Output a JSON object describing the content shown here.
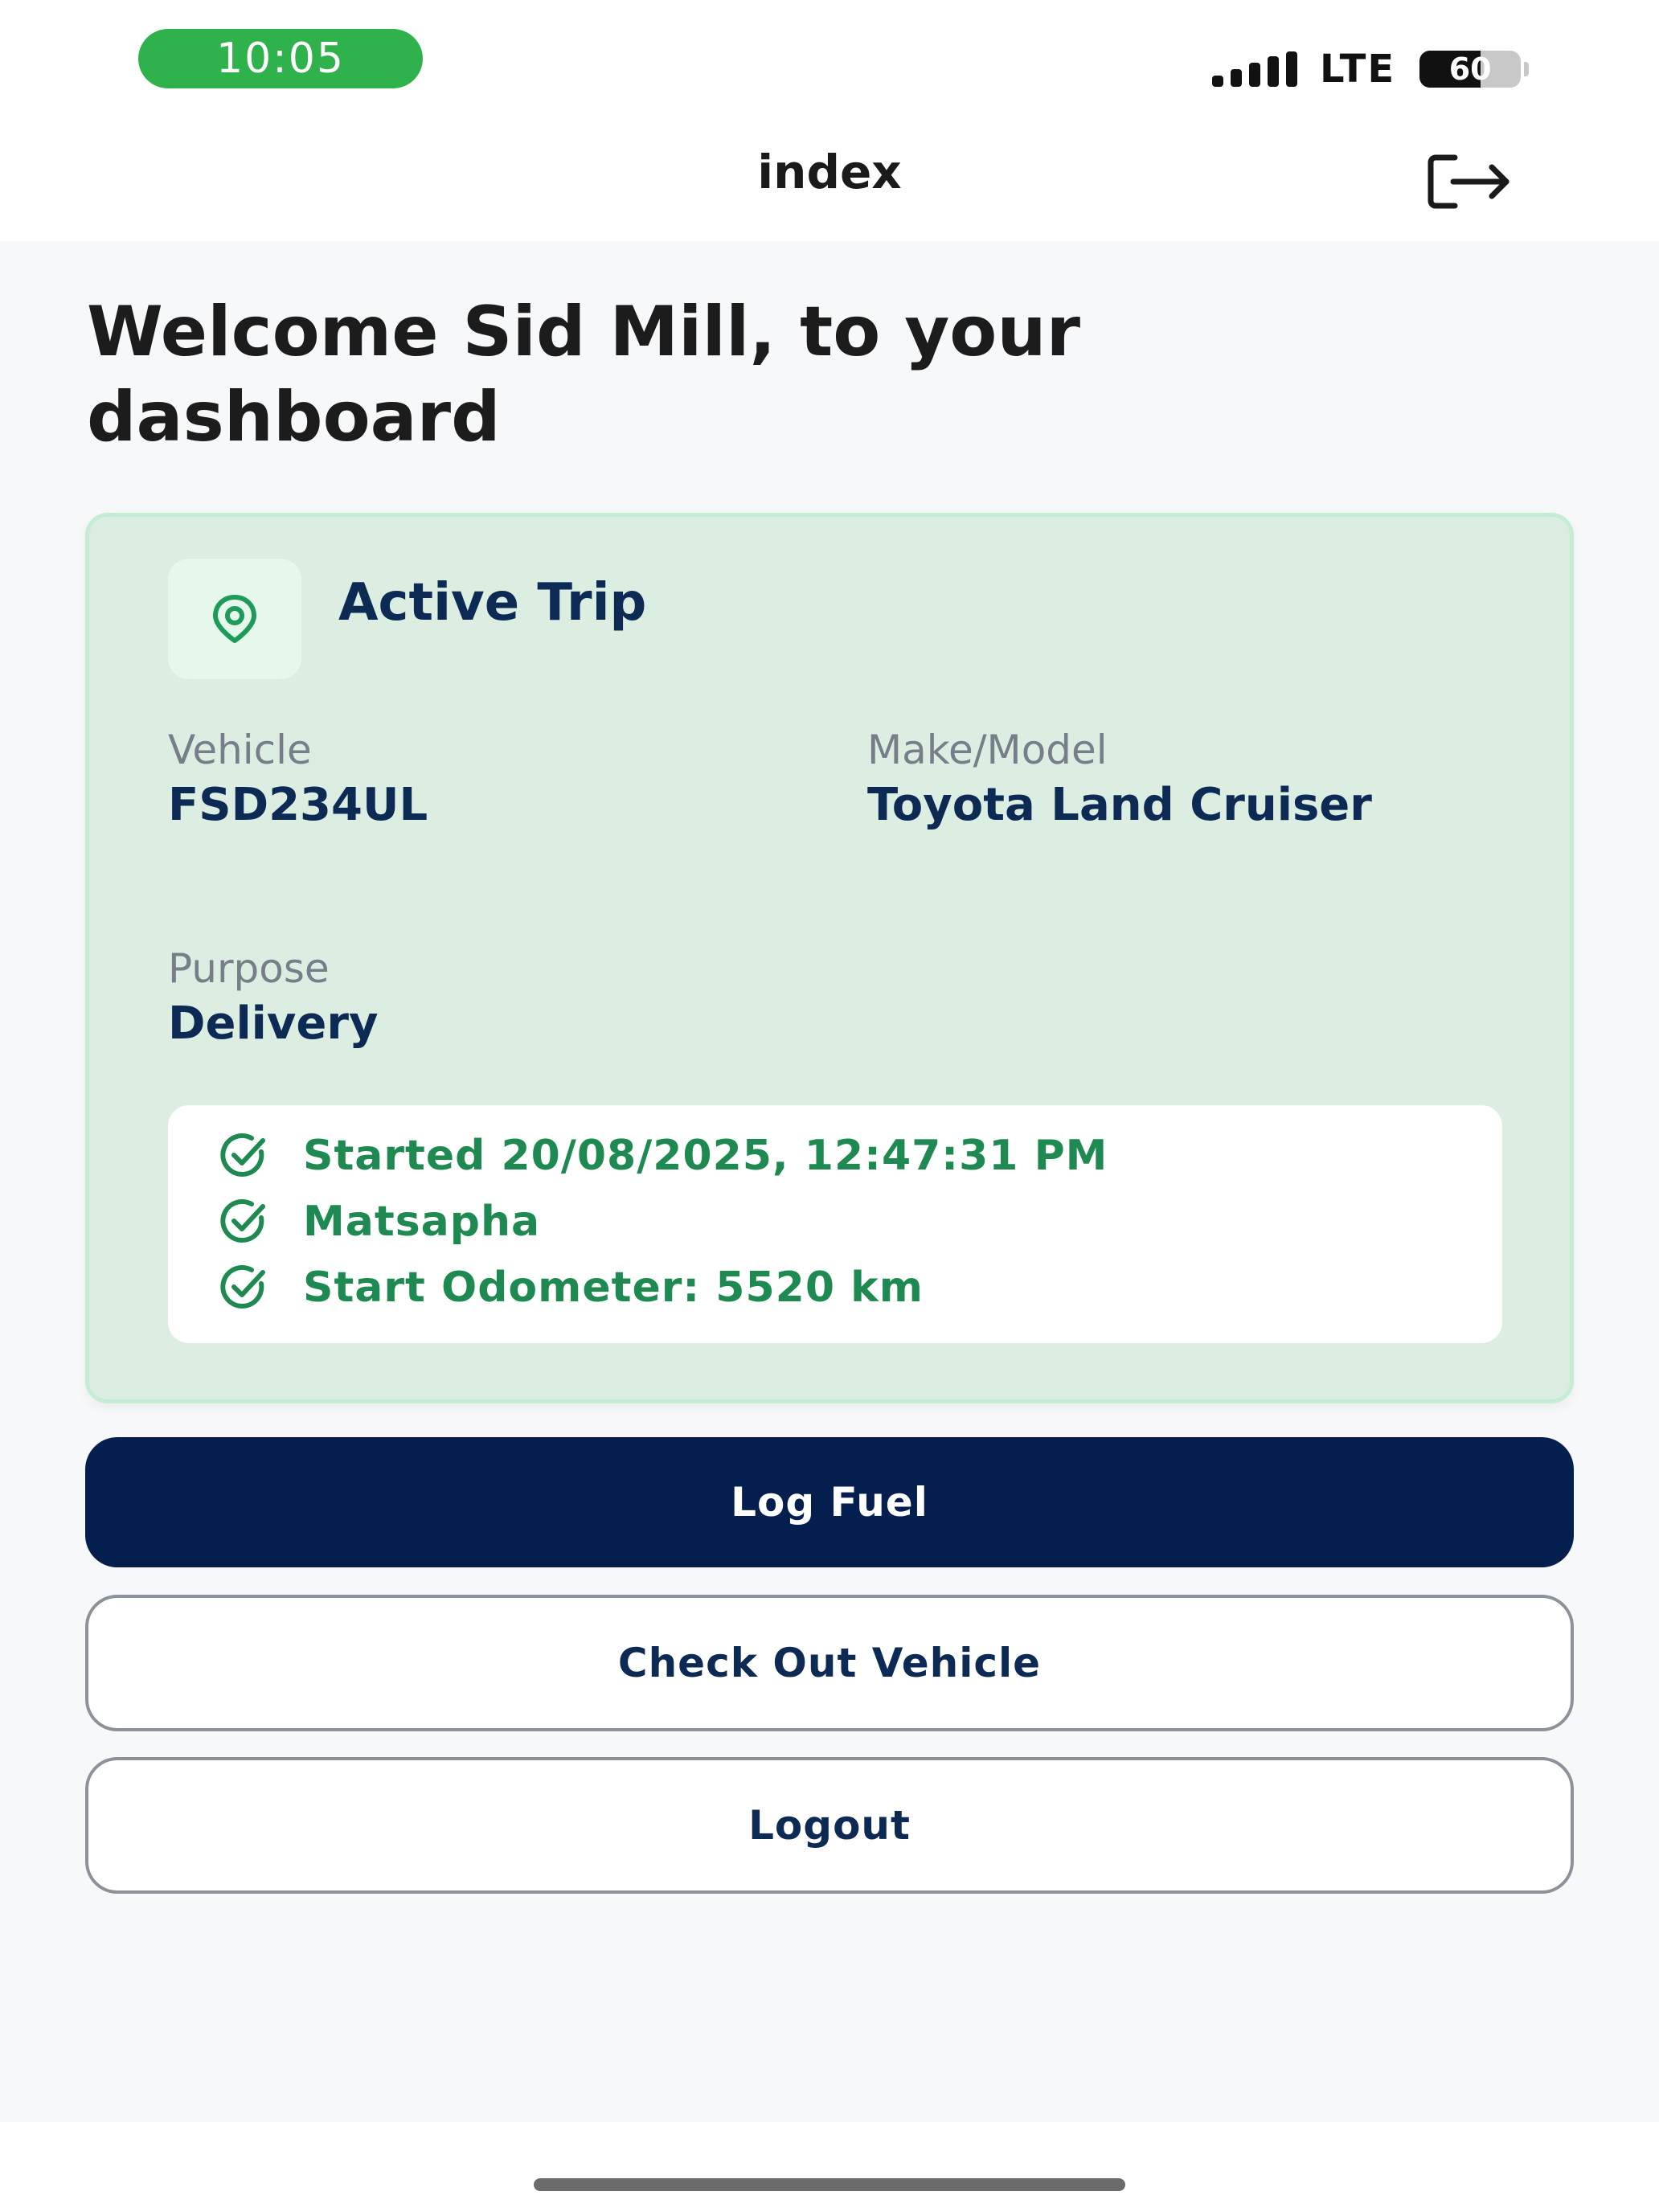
{
  "status_bar": {
    "time": "10:05",
    "network": "LTE",
    "battery_level": "60",
    "battery_fraction": 0.6,
    "time_pill_color": "#2fb24b"
  },
  "nav": {
    "title": "index",
    "exit_icon": "exit-arrow-icon"
  },
  "welcome": {
    "text": "Welcome Sid Mill, to your dashboard"
  },
  "active_trip": {
    "title": "Active Trip",
    "icon": "map-pin-icon",
    "vehicle_label": "Vehicle",
    "vehicle_value": "FSD234UL",
    "make_label": "Make/Model",
    "make_value": "Toyota Land Cruiser",
    "purpose_label": "Purpose",
    "purpose_value": "Delivery",
    "details": [
      {
        "icon": "check-circle-icon",
        "text": "Started 20/08/2025, 12:47:31 PM"
      },
      {
        "icon": "check-circle-icon",
        "text": "Matsapha"
      },
      {
        "icon": "check-circle-icon",
        "text": "Start Odometer: 5520 km"
      }
    ],
    "accent_color": "#1e8a52",
    "card_bg": "#dcede2"
  },
  "buttons": {
    "log_fuel": "Log Fuel",
    "check_out": "Check Out Vehicle",
    "logout": "Logout",
    "primary_color": "#041f4d"
  }
}
